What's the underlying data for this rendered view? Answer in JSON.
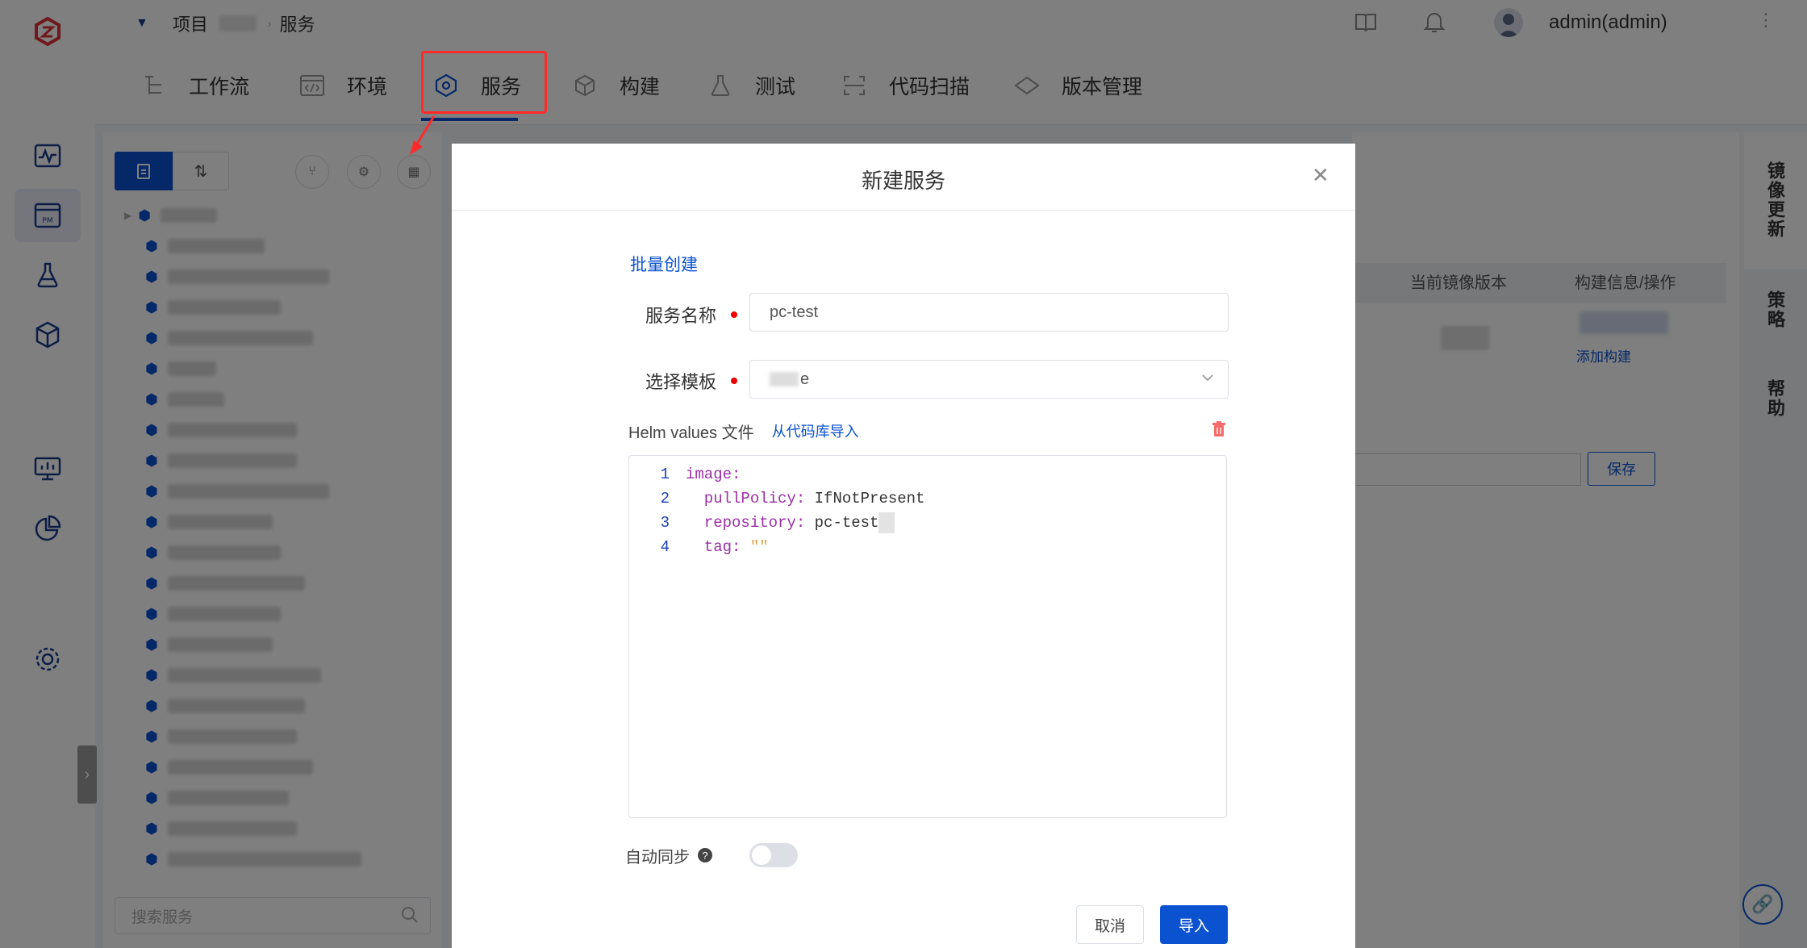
{
  "header": {
    "breadcrumb_project": "项目",
    "breadcrumb_service": "服务",
    "user": "admin(admin)"
  },
  "tabs": [
    {
      "label": "工作流"
    },
    {
      "label": "环境"
    },
    {
      "label": "服务"
    },
    {
      "label": "构建"
    },
    {
      "label": "测试"
    },
    {
      "label": "代码扫描"
    },
    {
      "label": "版本管理"
    }
  ],
  "service_list": {
    "search_placeholder": "搜索服务"
  },
  "right_panel": {
    "col_image_version": "当前镜像版本",
    "col_build_info": "构建信息/操作",
    "add_build": "添加构建",
    "save": "保存",
    "side_tabs": [
      "镜像更新",
      "策略",
      "帮助"
    ]
  },
  "modal": {
    "title": "新建服务",
    "batch_create": "批量创建",
    "service_name_label": "服务名称",
    "service_name_value": "pc-test",
    "template_label": "选择模板",
    "template_value": "e",
    "helm_label": "Helm values 文件",
    "import_from_repo": "从代码库导入",
    "code": [
      {
        "num": "1",
        "key": "image:",
        "val": ""
      },
      {
        "num": "2",
        "key": "  pullPolicy:",
        "val": " IfNotPresent"
      },
      {
        "num": "3",
        "key": "  repository:",
        "val": " pc-test"
      },
      {
        "num": "4",
        "key": "  tag:",
        "val": " \"\""
      }
    ],
    "auto_sync_label": "自动同步",
    "cancel": "取消",
    "import": "导入"
  },
  "colors": {
    "primary": "#0b52d1",
    "highlight": "#ff2a2a",
    "required": "#ee0000"
  }
}
